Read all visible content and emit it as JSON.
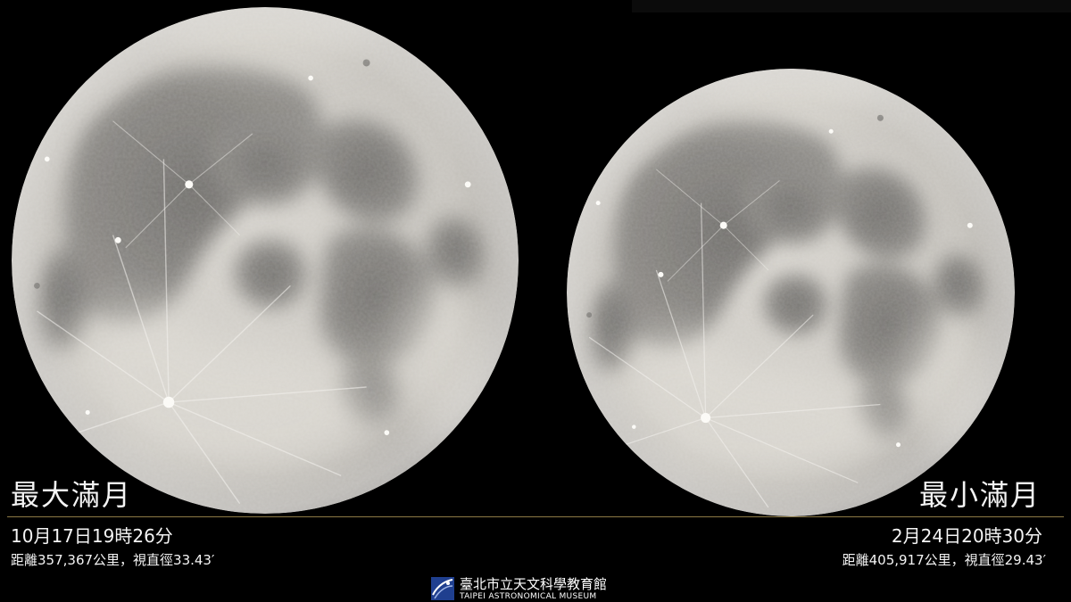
{
  "left_moon": {
    "title": "最大滿月",
    "datetime": "10月17日19時26分",
    "info": "距離357,367公里，視直徑33.43′"
  },
  "right_moon": {
    "title": "最小滿月",
    "datetime": "2月24日20時30分",
    "info": "距離405,917公里，視直徑29.43′"
  },
  "logo": {
    "name_cn": "臺北市立天文科學教育館",
    "name_en": "TAIPEI ASTRONOMICAL MUSEUM",
    "icon": "observatory-logo-icon"
  },
  "colors": {
    "background": "#000000",
    "divider": "#8c7a45",
    "text": "#f4f4f4"
  }
}
